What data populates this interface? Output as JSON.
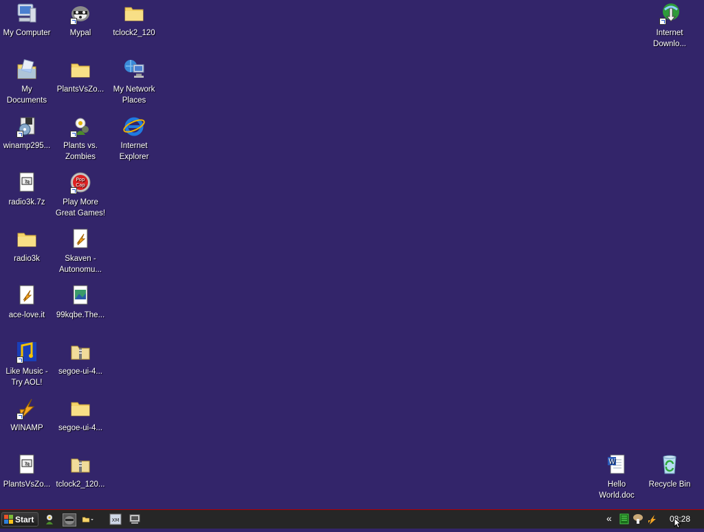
{
  "desktop": {
    "icons": [
      {
        "label": "My Computer"
      },
      {
        "label": "Mypal"
      },
      {
        "label": "tclock2_120"
      },
      {
        "label": "Internet Downlo..."
      },
      {
        "label": "My Documents"
      },
      {
        "label": "PlantsVsZo..."
      },
      {
        "label": "My Network Places"
      },
      {
        "label": "winamp295..."
      },
      {
        "label": "Plants vs. Zombies"
      },
      {
        "label": "Internet Explorer"
      },
      {
        "label": "radio3k.7z"
      },
      {
        "label": "Play More Great Games!"
      },
      {
        "label": "radio3k"
      },
      {
        "label": "Skaven - Autonomu..."
      },
      {
        "label": "ace-love.it"
      },
      {
        "label": "99kqbe.The..."
      },
      {
        "label": "Like Music - Try AOL!"
      },
      {
        "label": "segoe-ui-4..."
      },
      {
        "label": "WINAMP"
      },
      {
        "label": "segoe-ui-4..."
      },
      {
        "label": "PlantsVsZo..."
      },
      {
        "label": "tclock2_120..."
      },
      {
        "label": "Hello World.doc"
      },
      {
        "label": "Recycle Bin"
      }
    ]
  },
  "taskbar": {
    "start_label": "Start",
    "tray_expand": "«",
    "clock": "08:28"
  },
  "colors": {
    "desktop_bg": "#33256a",
    "taskbar_bg": "#262626",
    "taskbar_border": "#b00000"
  }
}
